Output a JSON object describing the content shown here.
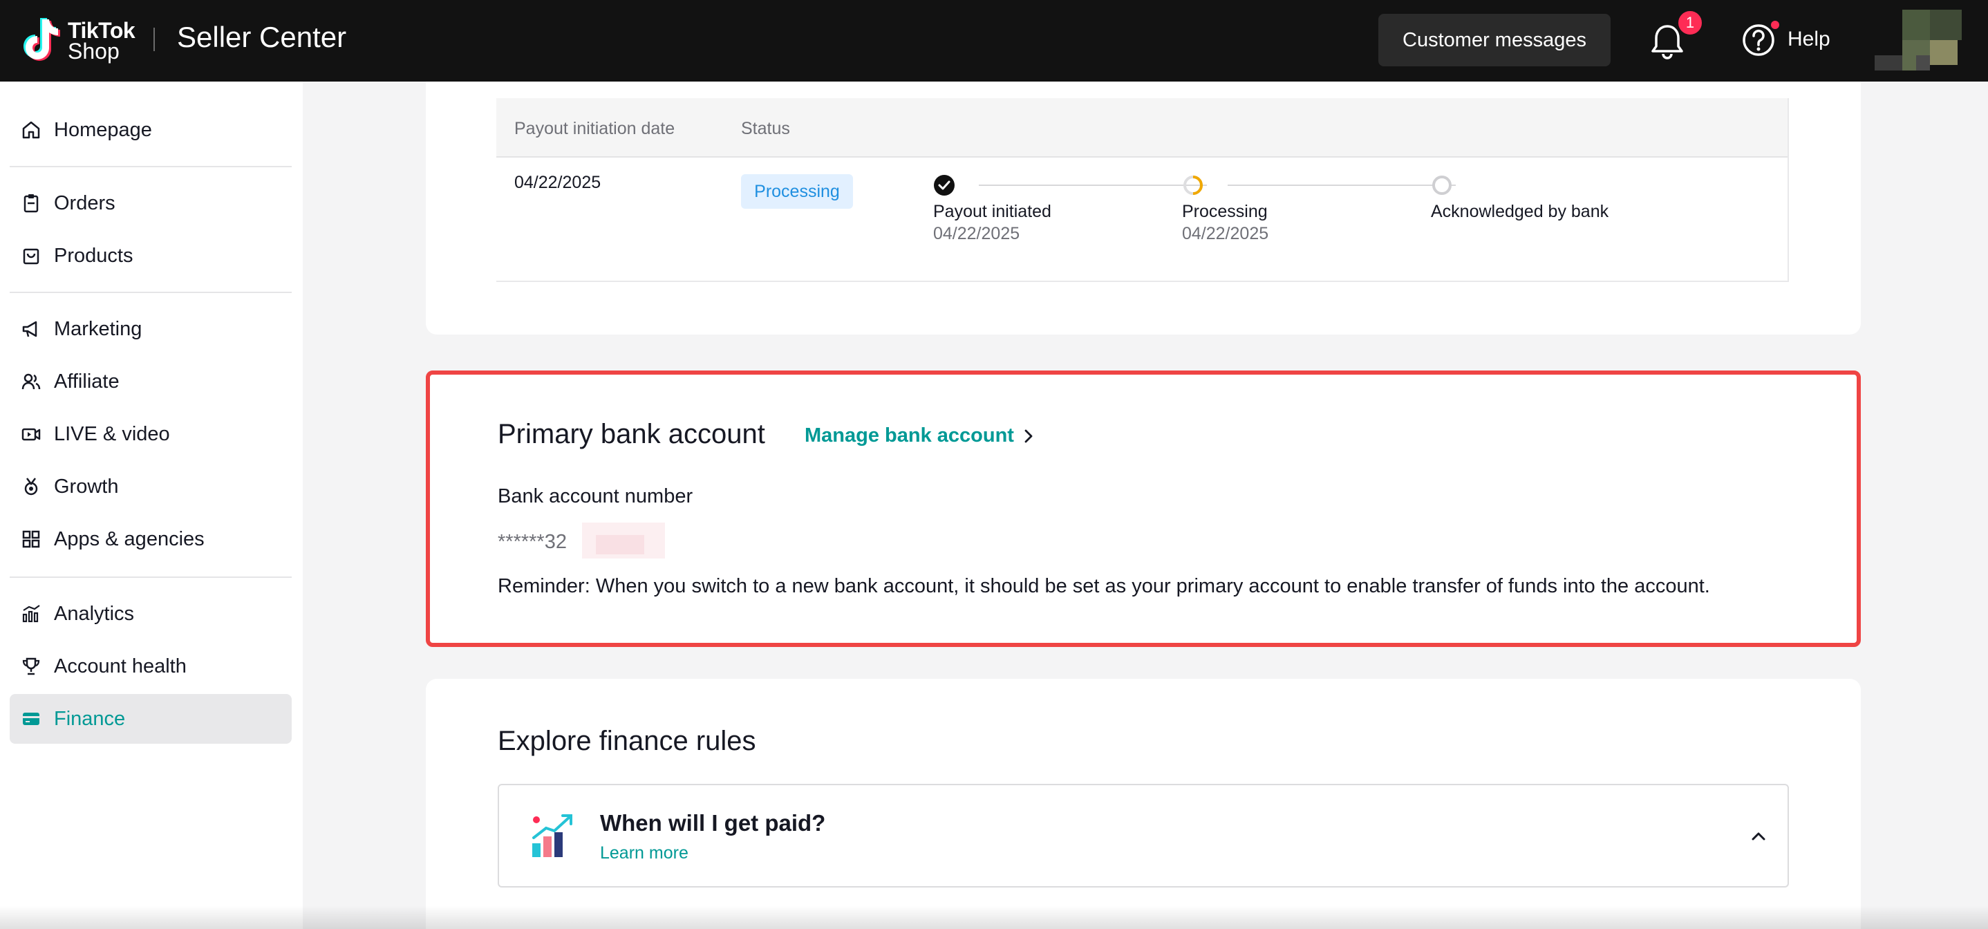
{
  "header": {
    "logo_word1": "TikTok",
    "logo_word2": "Shop",
    "title": "Seller Center",
    "customer_messages": "Customer messages",
    "notification_count": "1",
    "help": "Help"
  },
  "sidebar": {
    "items": [
      {
        "label": "Homepage",
        "icon": "home-icon"
      },
      {
        "label": "Orders",
        "icon": "clipboard-icon"
      },
      {
        "label": "Products",
        "icon": "bag-icon"
      },
      {
        "label": "Marketing",
        "icon": "megaphone-icon"
      },
      {
        "label": "Affiliate",
        "icon": "people-icon"
      },
      {
        "label": "LIVE & video",
        "icon": "video-icon"
      },
      {
        "label": "Growth",
        "icon": "medal-icon"
      },
      {
        "label": "Apps & agencies",
        "icon": "apps-icon"
      },
      {
        "label": "Analytics",
        "icon": "chart-icon"
      },
      {
        "label": "Account health",
        "icon": "trophy-icon"
      },
      {
        "label": "Finance",
        "icon": "card-icon",
        "active": true
      }
    ],
    "accent_color": "#009995"
  },
  "payout_table": {
    "col_date": "Payout initiation date",
    "col_status": "Status",
    "row": {
      "date": "04/22/2025",
      "status": "Processing",
      "steps": [
        {
          "label": "Payout initiated",
          "date": "04/22/2025",
          "state": "done"
        },
        {
          "label": "Processing",
          "date": "04/22/2025",
          "state": "in-progress"
        },
        {
          "label": "Acknowledged by bank",
          "date": "",
          "state": "pending"
        }
      ]
    }
  },
  "bank": {
    "title": "Primary bank account",
    "manage_link": "Manage bank account",
    "number_label": "Bank account number",
    "number_value": "******32",
    "reminder": "Reminder: When you switch to a new bank account, it should be set as your primary account to enable transfer of funds into the account.",
    "highlight_color": "#ef4444"
  },
  "explore": {
    "title": "Explore finance rules",
    "faq_question": "When will I get paid?",
    "faq_link": "Learn more"
  }
}
